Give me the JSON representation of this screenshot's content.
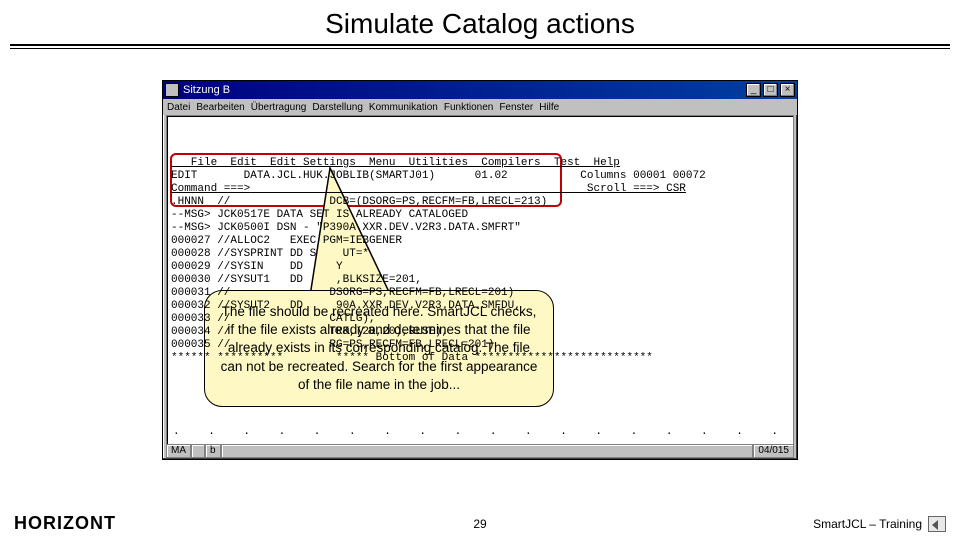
{
  "slide": {
    "title": "Simulate Catalog actions"
  },
  "window": {
    "title": "Sitzung B",
    "menubar": [
      "Datei",
      "Bearbeiten",
      "Übertragung",
      "Darstellung",
      "Kommunikation",
      "Funktionen",
      "Fenster",
      "Hilfe"
    ],
    "controls": {
      "min": "_",
      "max": "□",
      "close": "×"
    }
  },
  "editor": {
    "menu": "   File  Edit  Edit Settings  Menu  Utilities  Compilers  Test  Help",
    "header_left": "EDIT       DATA.JCL.HUK.JOBLIB(SMARTJ01)      01.02",
    "header_right": "Columns 00001 00072",
    "cmd_left": "Command ===>",
    "cmd_right": "Scroll ===> CSR",
    "lines": [
      ".HNNN  //               DCB=(DSORG=PS,RECFM=FB,LRECL=213)",
      "--MSG> JCK0517E DATA SET IS ALREADY CATALOGED",
      "--MSG> JCK0500I DSN - \"P390A.XXR.DEV.V2R3.DATA.SMFRT\"",
      "000027 //ALLOC2   EXEC PGM=IEBGENER",
      "000028 //SYSPRINT DD S    UT=*",
      "000029 //SYSIN    DD     Y",
      "000030 //SYSUT1   DD     ,BLKSIZE=201,",
      "000031 //               DSORG=PS,RECFM=FB,LRECL=201)",
      "000032 //SYSUT2   DD     90A.XXR.DEV.V2R3.DATA.SMFDU,",
      "000033 //               CATLG),",
      "000034 //               TRK,(20,20),RLSE),",
      "000035 //               RG=PS,RECFM=FB,LRECL=201)",
      "****** **********        ***** Bottom of Data ***************************"
    ]
  },
  "callout": {
    "text": "The file should be recreated here. SmartJCL checks, if the file exists already and determines that the file already exists in its corresponding catalog. The file can not be recreated. Search for the first appearance of the file name in the job..."
  },
  "statusbar": {
    "left1": "MA",
    "left2": "b",
    "right": "04/015"
  },
  "footer": {
    "brand": "HORIZONT",
    "page": "29",
    "right": "SmartJCL – Training"
  }
}
